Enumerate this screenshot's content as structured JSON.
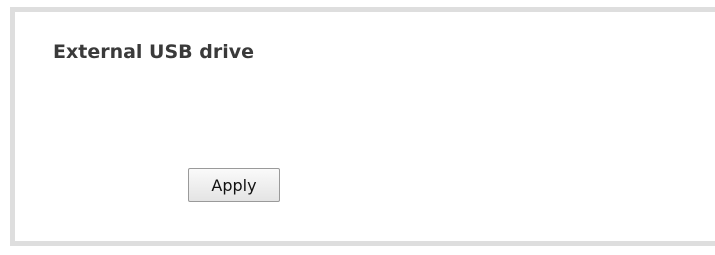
{
  "panel": {
    "title": "External USB drive",
    "apply_label": "Apply"
  }
}
